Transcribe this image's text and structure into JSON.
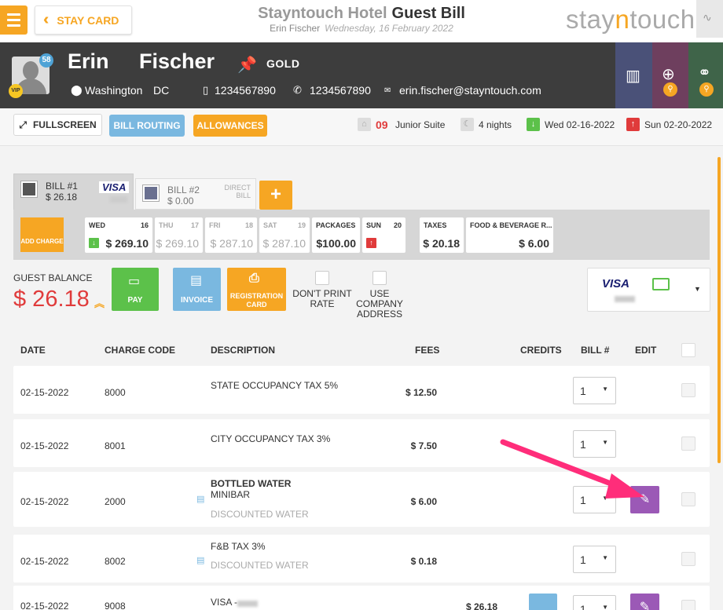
{
  "header": {
    "stay_card_label": "STAY CARD",
    "hotel_name": "Stayntouch Hotel",
    "page_title": "Guest Bill",
    "user_name": "Erin Fischer",
    "date": "Wednesday, 16 February 2022",
    "logo_left": "stay",
    "logo_mid": "n",
    "logo_right": "touch"
  },
  "guest": {
    "first_name": "Erin",
    "last_name": "Fischer",
    "badge_count": "58",
    "vip": "VIP",
    "membership": "GOLD",
    "city": "Washington",
    "state": "DC",
    "mobile": "1234567890",
    "phone": "1234567890",
    "email": "erin.fischer@stayntouch.com"
  },
  "actions": {
    "fullscreen": "FULLSCREEN",
    "bill_routing": "BILL ROUTING",
    "allowances": "ALLOWANCES"
  },
  "room": {
    "number": "09",
    "type": "Junior Suite",
    "nights": "4 nights",
    "arrival": "Wed 02-16-2022",
    "departure": "Sun 02-20-2022"
  },
  "bills": [
    {
      "label": "BILL #1",
      "amount": "$ 26.18",
      "card": "VISA"
    },
    {
      "label": "BILL #2",
      "amount": "$ 0.00",
      "card": "DIRECT BILL"
    }
  ],
  "add_bill": "+",
  "add_charge": "ADD CHARGE",
  "days": [
    {
      "name": "WED",
      "date": "16",
      "value": "$ 269.10",
      "arrow": "↓",
      "arrow_color": "#5cc14a"
    },
    {
      "name": "THU",
      "date": "17",
      "value": "$ 269.10"
    },
    {
      "name": "FRI",
      "date": "18",
      "value": "$ 287.10"
    },
    {
      "name": "SAT",
      "date": "19",
      "value": "$ 287.10"
    },
    {
      "name": "PACKAGES",
      "date": "",
      "value": "$100.00"
    },
    {
      "name": "SUN",
      "date": "20",
      "value": "",
      "arrow": "↑",
      "arrow_color": "#e03b3b"
    },
    {
      "name": "TAXES",
      "date": "",
      "value": "$ 20.18"
    },
    {
      "name": "FOOD & BEVERAGE R...",
      "date": "",
      "value": "$ 6.00"
    }
  ],
  "balance": {
    "caption": "GUEST BALANCE",
    "value": "$ 26.18",
    "pay": "PAY",
    "invoice": "INVOICE",
    "registration_card": "REGISTRATION CARD",
    "dont_print_rate": "DON'T PRINT RATE",
    "use_company_address": "USE COMPANY ADDRESS",
    "card": "VISA"
  },
  "table": {
    "headers": [
      "DATE",
      "CHARGE CODE",
      "DESCRIPTION",
      "FEES",
      "CREDITS",
      "BILL #",
      "EDIT"
    ],
    "rows": [
      {
        "date": "02-15-2022",
        "code": "8000",
        "desc": "STATE OCCUPANCY TAX 5%",
        "desc2": "",
        "note": "",
        "fees": "$ 12.50",
        "credits": "",
        "bill": "1"
      },
      {
        "date": "02-15-2022",
        "code": "8001",
        "desc": "CITY OCCUPANCY TAX 3%",
        "desc2": "",
        "note": "",
        "fees": "$ 7.50",
        "credits": "",
        "bill": "1"
      },
      {
        "date": "02-15-2022",
        "code": "2000",
        "desc": "BOTTLED WATER",
        "desc2": "MINIBAR",
        "note": "DISCOUNTED WATER",
        "fees": "$ 6.00",
        "credits": "",
        "bill": "1"
      },
      {
        "date": "02-15-2022",
        "code": "8002",
        "desc": "F&B TAX 3%",
        "desc2": "",
        "note": "DISCOUNTED WATER",
        "fees": "$ 0.18",
        "credits": "",
        "bill": "1"
      },
      {
        "date": "02-15-2022",
        "code": "9008",
        "desc": "VISA -",
        "desc2": "",
        "note": "",
        "fees": "",
        "credits": "$ 26.18",
        "bill": "1"
      }
    ]
  },
  "colors": {
    "accent": "#f6a623",
    "blue": "#7ab8e0",
    "green": "#5cc14a",
    "red": "#e03b3b",
    "purple": "#9b59b6",
    "arrow": "#ff2d7a"
  }
}
